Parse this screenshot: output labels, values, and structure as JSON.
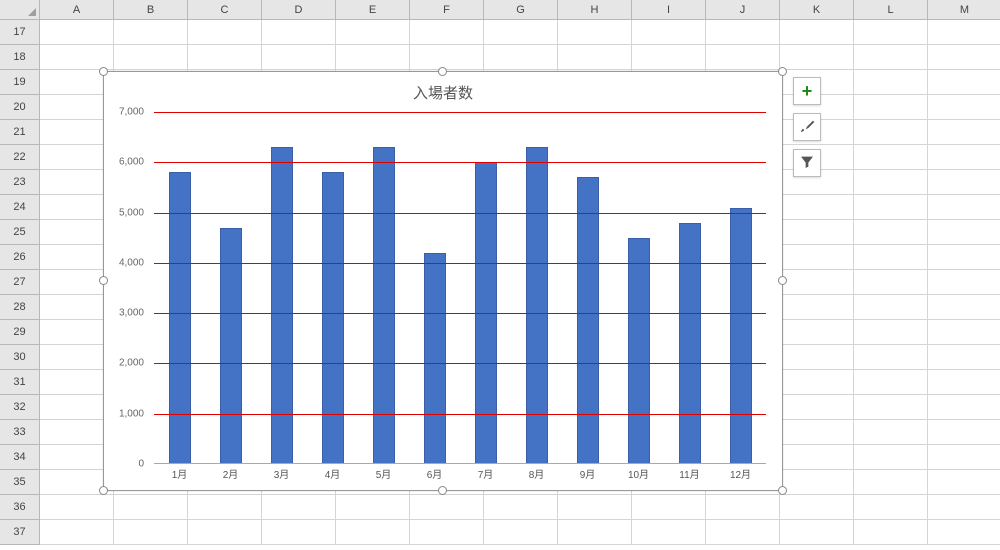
{
  "columns": [
    "A",
    "B",
    "C",
    "D",
    "E",
    "F",
    "G",
    "H",
    "I",
    "J",
    "K",
    "L",
    "M"
  ],
  "row_start": 17,
  "row_end": 37,
  "chart_data": {
    "type": "bar",
    "title": "入場者数",
    "categories": [
      "1月",
      "2月",
      "3月",
      "4月",
      "5月",
      "6月",
      "7月",
      "8月",
      "9月",
      "10月",
      "11月",
      "12月"
    ],
    "values": [
      5800,
      4700,
      6300,
      5800,
      6300,
      4200,
      6000,
      6300,
      5700,
      4500,
      4800,
      5100
    ],
    "y_ticks": [
      0,
      1000,
      2000,
      3000,
      4000,
      5000,
      6000,
      7000
    ],
    "y_tick_labels": [
      "0",
      "1,000",
      "2,000",
      "3,000",
      "4,000",
      "5,000",
      "6,000",
      "7,000"
    ],
    "ylim": [
      0,
      7000
    ],
    "xlabel": "",
    "ylabel": "",
    "gridline_color": "#e00000",
    "bar_color": "#4472c4"
  },
  "tools": {
    "add": "Chart Elements",
    "style": "Chart Styles",
    "filter": "Chart Filters"
  }
}
